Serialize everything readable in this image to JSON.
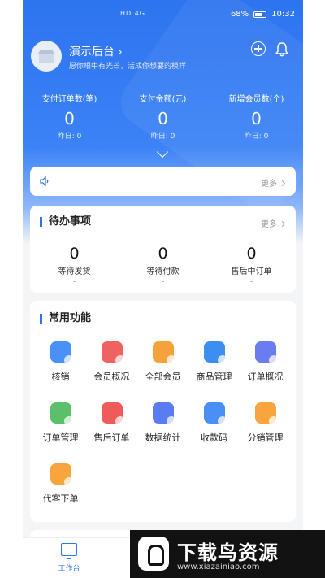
{
  "statusbar": {
    "network": "HD 4G",
    "battery": "68%",
    "time": "10:32"
  },
  "header": {
    "store_name": "演示后台",
    "motto": "愿你眼中有光芒，活成你想要的模样"
  },
  "stats": [
    {
      "label": "支付订单数(笔)",
      "value": "0",
      "yesterday": "昨日: 0"
    },
    {
      "label": "支付金额(元)",
      "value": "0",
      "yesterday": "昨日: 0"
    },
    {
      "label": "新增会员数(个)",
      "value": "0",
      "yesterday": "昨日: 0"
    }
  ],
  "notice": {
    "more": "更多"
  },
  "todo": {
    "title": "待办事项",
    "more": "更多",
    "items": [
      {
        "value": "0",
        "label": "等待发货"
      },
      {
        "value": "0",
        "label": "等待付款"
      },
      {
        "value": "0",
        "label": "售后中订单"
      }
    ]
  },
  "features": {
    "title": "常用功能",
    "items": [
      {
        "label": "核销",
        "icon": "verify-icon",
        "color": "#4b8ff8"
      },
      {
        "label": "会员概况",
        "icon": "member-overview-icon",
        "color": "#f06262"
      },
      {
        "label": "全部会员",
        "icon": "all-members-icon",
        "color": "#f5a13c"
      },
      {
        "label": "商品管理",
        "icon": "cart-icon",
        "color": "#3d8ef0"
      },
      {
        "label": "订单概况",
        "icon": "order-overview-icon",
        "color": "#6b7cf0"
      },
      {
        "label": "订单管理",
        "icon": "order-manage-icon",
        "color": "#5cbf6a"
      },
      {
        "label": "售后订单",
        "icon": "after-sale-icon",
        "color": "#ef5a5a"
      },
      {
        "label": "数据统计",
        "icon": "data-stats-icon",
        "color": "#5a7cf2"
      },
      {
        "label": "收款码",
        "icon": "qrcode-icon",
        "color": "#4a8ff5"
      },
      {
        "label": "分销管理",
        "icon": "distribution-icon",
        "color": "#f6a63d"
      },
      {
        "label": "代客下单",
        "icon": "proxy-order-icon",
        "color": "#f6a63d"
      }
    ]
  },
  "tabbar": {
    "items": [
      {
        "label": "工作台",
        "active": true
      }
    ]
  },
  "watermark": {
    "title": "下载鸟资源",
    "url": "www.xiazainiao.com"
  }
}
